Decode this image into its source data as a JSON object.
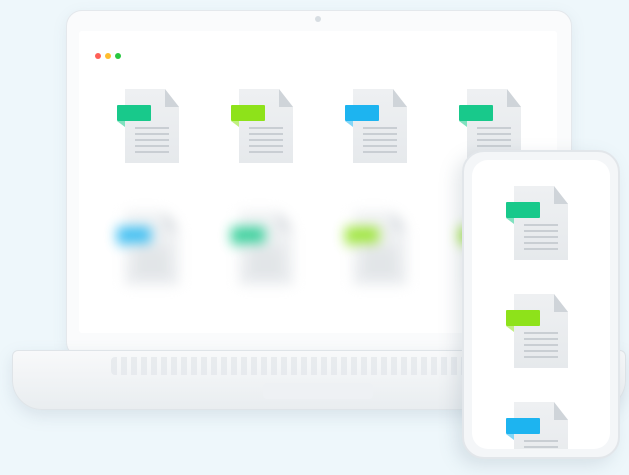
{
  "window": {
    "dots": [
      {
        "name": "close-dot",
        "color": "#ff5f57"
      },
      {
        "name": "minimize-dot",
        "color": "#ffbd2e"
      },
      {
        "name": "maximize-dot",
        "color": "#28c840"
      }
    ]
  },
  "laptop": {
    "files_row1": [
      {
        "icon": "document-icon",
        "tab_color": "#18c98b"
      },
      {
        "icon": "document-icon",
        "tab_color": "#8ee21a"
      },
      {
        "icon": "document-icon",
        "tab_color": "#1db4f0"
      },
      {
        "icon": "document-icon",
        "tab_color": "#18c98b"
      }
    ],
    "files_row2_blurred": [
      {
        "icon": "document-icon",
        "tab_color": "#1db4f0"
      },
      {
        "icon": "document-icon",
        "tab_color": "#18c98b"
      },
      {
        "icon": "document-icon",
        "tab_color": "#8ee21a"
      },
      {
        "icon": "document-icon",
        "tab_color": "#8ee21a"
      }
    ]
  },
  "phone": {
    "files": [
      {
        "icon": "document-icon",
        "tab_color": "#18c98b"
      },
      {
        "icon": "document-icon",
        "tab_color": "#8ee21a"
      },
      {
        "icon": "document-icon",
        "tab_color": "#1db4f0"
      }
    ]
  }
}
